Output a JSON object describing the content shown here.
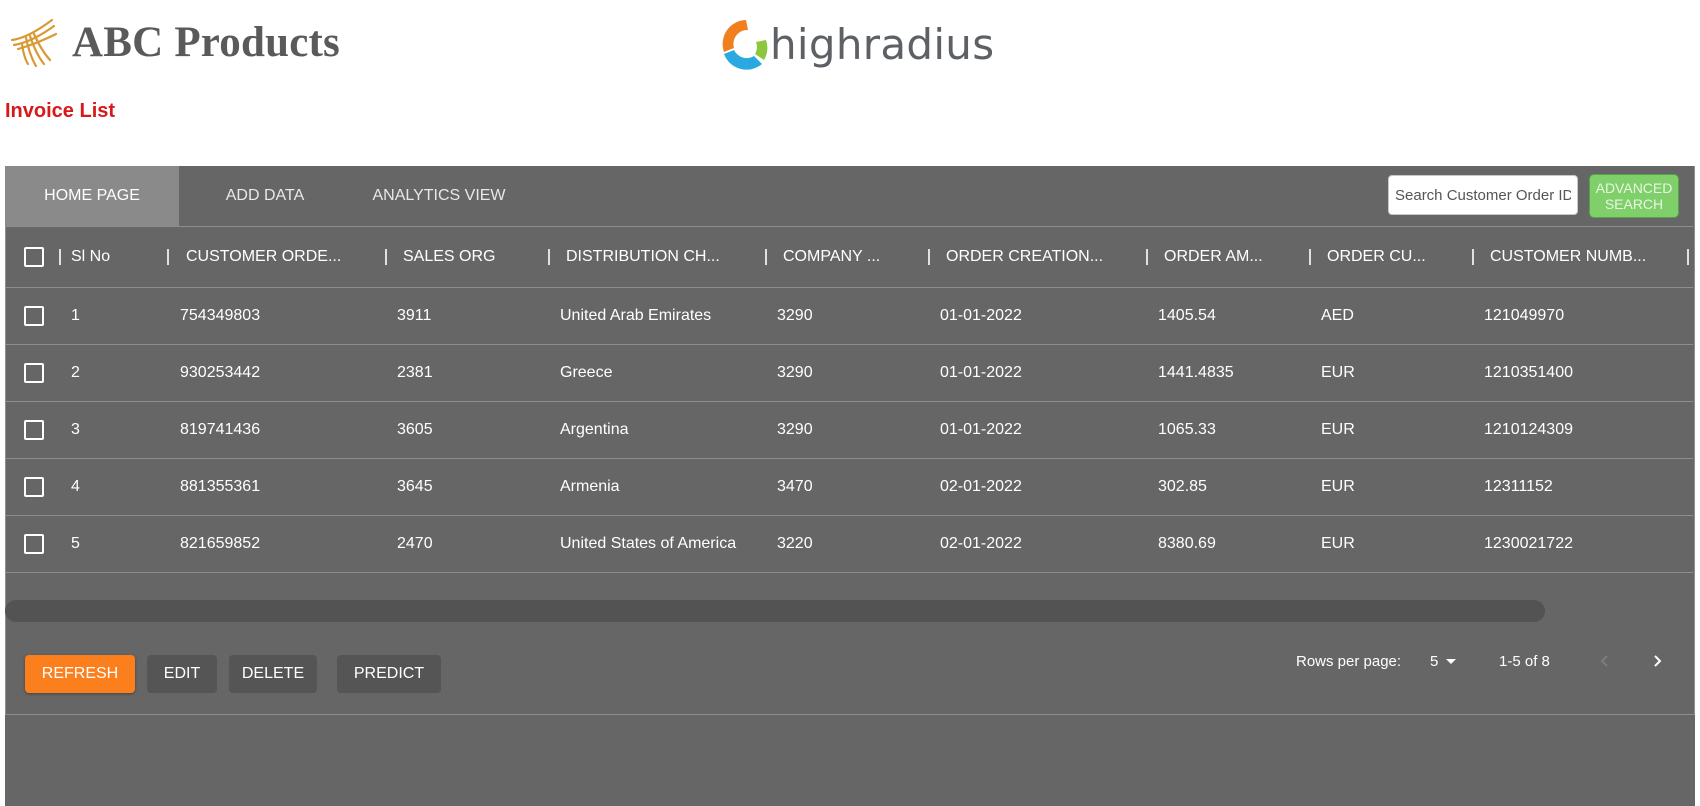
{
  "header": {
    "brand_name": "ABC Products",
    "partner_logo_text": "highradius",
    "page_title": "Invoice List"
  },
  "tabs": [
    {
      "label": "HOME PAGE",
      "active": true
    },
    {
      "label": "ADD DATA",
      "active": false
    },
    {
      "label": "ANALYTICS VIEW",
      "active": false
    }
  ],
  "search": {
    "placeholder": "Search Customer Order ID",
    "value": "",
    "advanced_label_line1": "ADVANCED",
    "advanced_label_line2": "SEARCH"
  },
  "table": {
    "columns": [
      "Sl No",
      "CUSTOMER ORDE...",
      "SALES ORG",
      "DISTRIBUTION CH...",
      "COMPANY ...",
      "ORDER CREATION...",
      "ORDER AM...",
      "ORDER CU...",
      "CUSTOMER NUMB..."
    ],
    "rows": [
      {
        "checked": false,
        "cells": [
          "1",
          "754349803",
          "3911",
          "United Arab Emirates",
          "3290",
          "01-01-2022",
          "1405.54",
          "AED",
          "121049970"
        ]
      },
      {
        "checked": false,
        "cells": [
          "2",
          "930253442",
          "2381",
          "Greece",
          "3290",
          "01-01-2022",
          "1441.4835",
          "EUR",
          "1210351400"
        ]
      },
      {
        "checked": false,
        "cells": [
          "3",
          "819741436",
          "3605",
          "Argentina",
          "3290",
          "01-01-2022",
          "1065.33",
          "EUR",
          "1210124309"
        ]
      },
      {
        "checked": false,
        "cells": [
          "4",
          "881355361",
          "3645",
          "Armenia",
          "3470",
          "02-01-2022",
          "302.85",
          "EUR",
          "12311152"
        ]
      },
      {
        "checked": false,
        "cells": [
          "5",
          "821659852",
          "2470",
          "United States of America",
          "3220",
          "02-01-2022",
          "8380.69",
          "EUR",
          "1230021722"
        ]
      }
    ]
  },
  "actions": {
    "refresh": "REFRESH",
    "edit": "EDIT",
    "delete": "DELETE",
    "predict": "PREDICT"
  },
  "pagination": {
    "rows_per_page_label": "Rows per page:",
    "rows_per_page_value": "5",
    "range": "1-5 of 8"
  },
  "colors": {
    "title_red": "#d61a1a",
    "panel_gray": "#666666",
    "active_tab": "#8a8a8a",
    "refresh_orange": "#fc7f1e",
    "advanced_green": "#7fcf6a",
    "logo_orange": "#f07f1d",
    "logo_blue": "#2aa9e0",
    "logo_green": "#8dc63f"
  },
  "icons": {
    "brand_logo": "wheat-logo-icon",
    "partner_logo": "highradius-swirl-icon",
    "prev_page": "chevron-left-icon",
    "next_page": "chevron-right-icon",
    "rows_dropdown": "caret-down-icon"
  }
}
